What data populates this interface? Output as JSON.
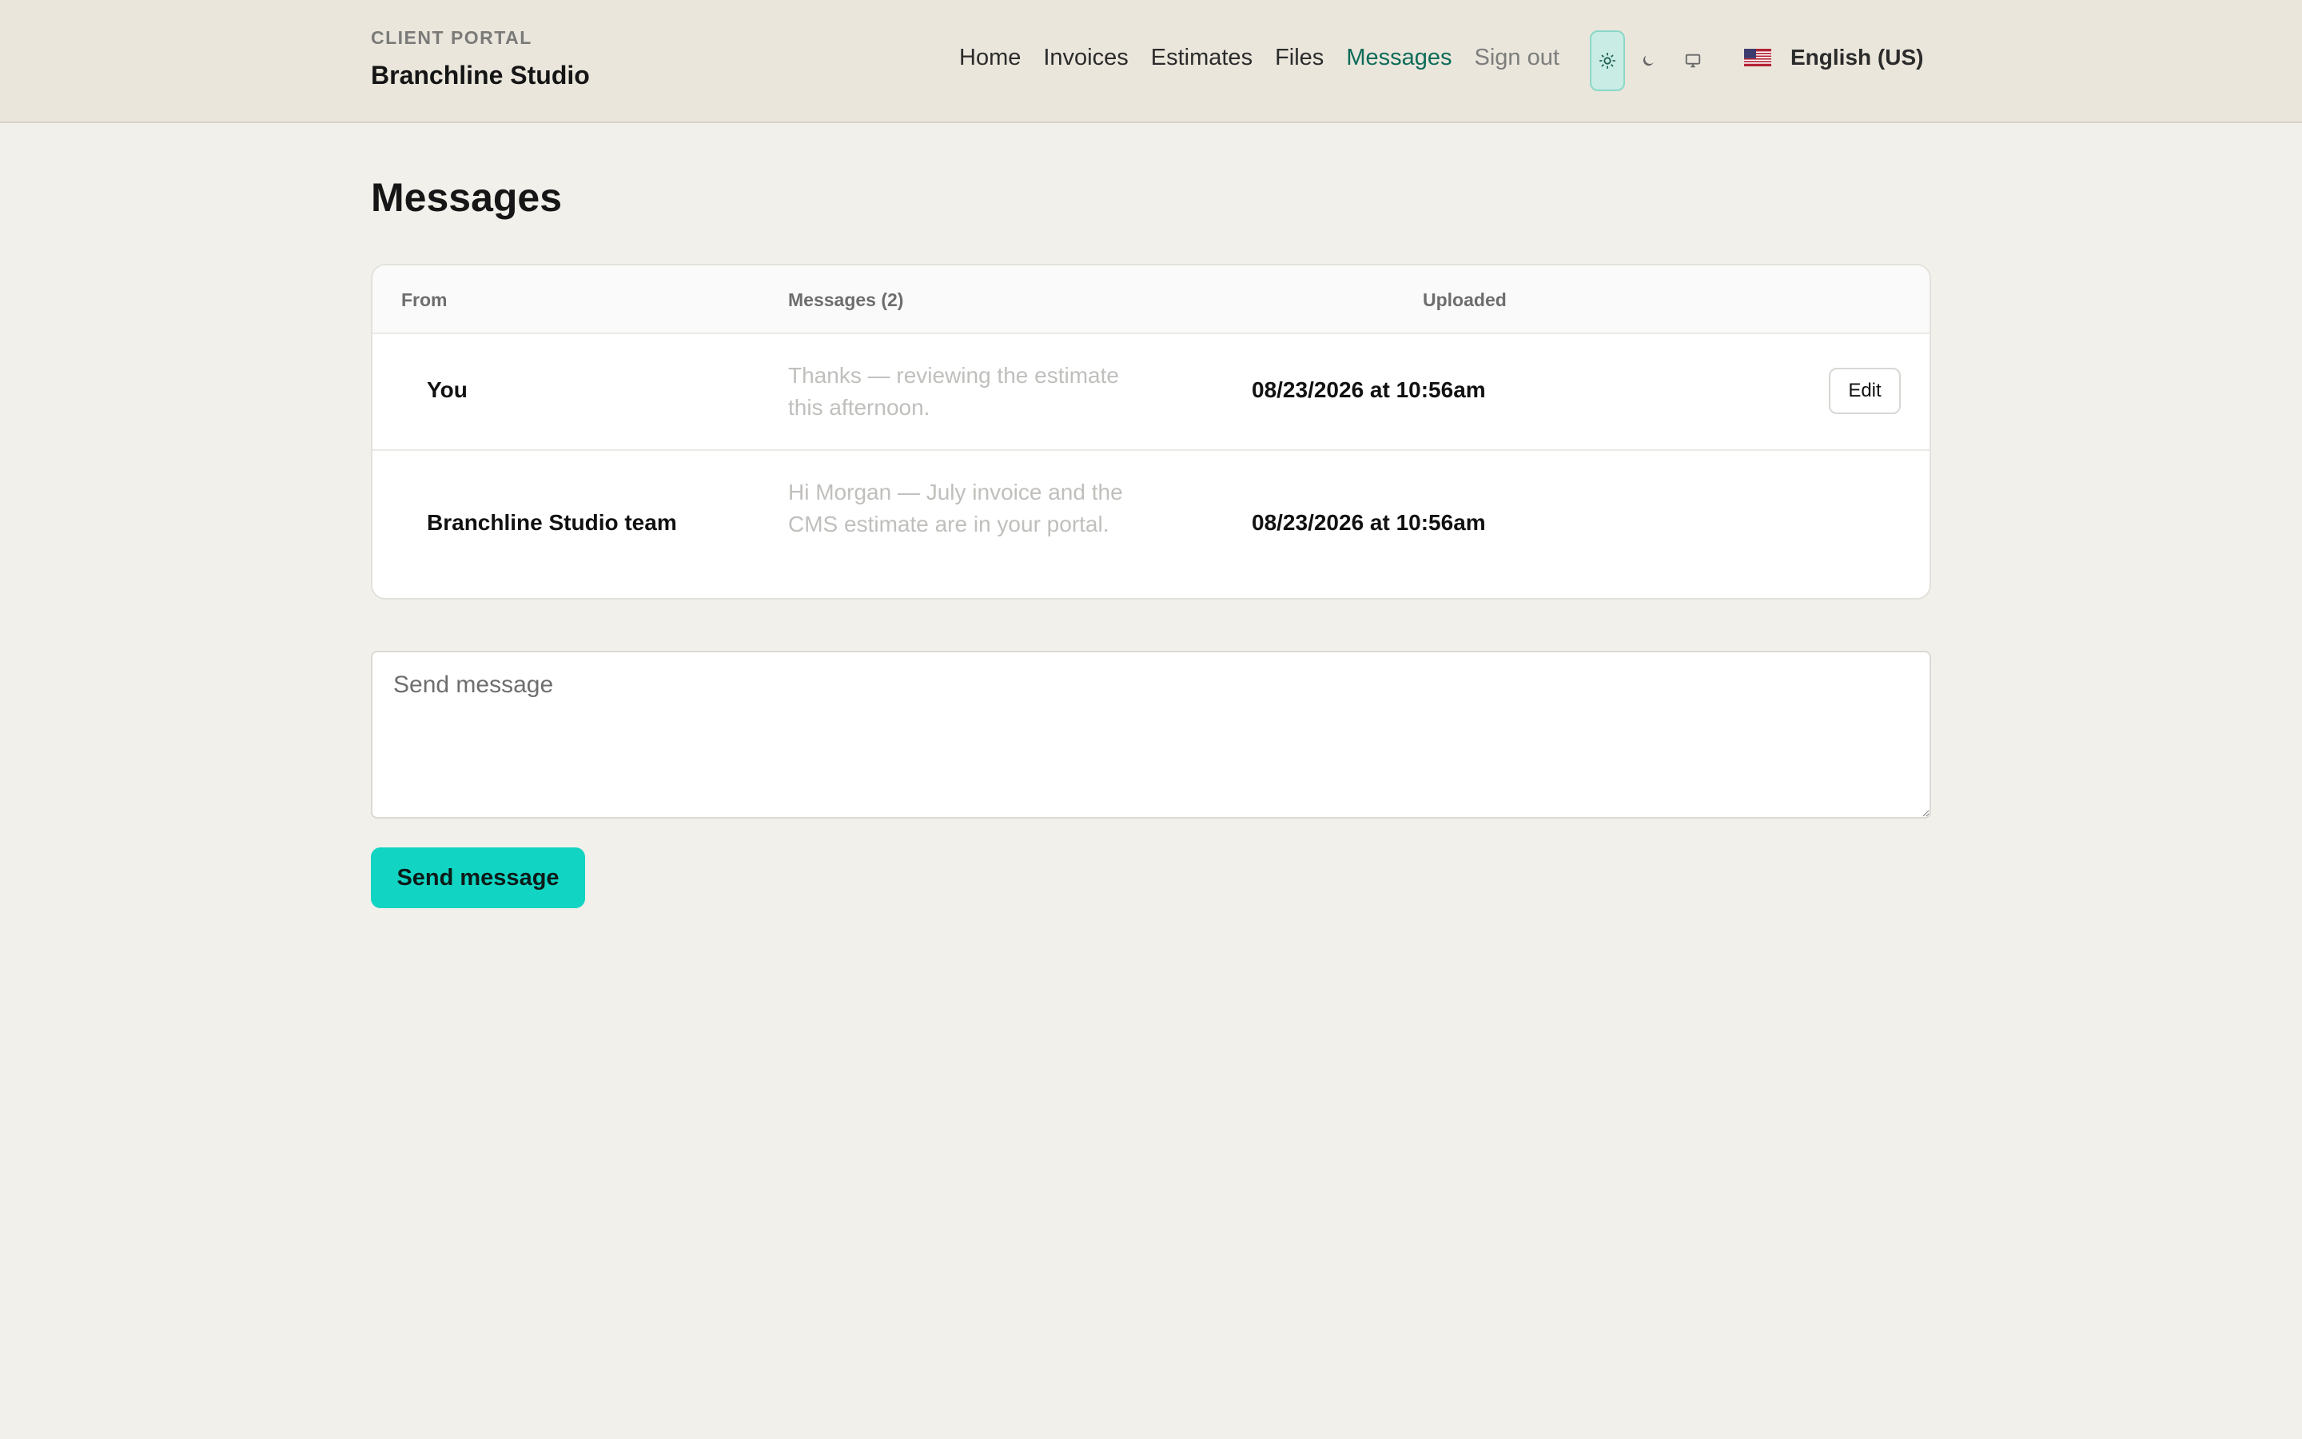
{
  "header": {
    "kicker": "CLIENT PORTAL",
    "brand": "Branchline Studio",
    "nav": {
      "home": "Home",
      "invoices": "Invoices",
      "estimates": "Estimates",
      "files": "Files",
      "messages": "Messages",
      "signout": "Sign out"
    },
    "active_nav": "Messages",
    "theme_active": "light",
    "language": "English (US)"
  },
  "main": {
    "title": "Messages",
    "table": {
      "col_from": "From",
      "col_messages": "Messages (2)",
      "col_uploaded": "Uploaded",
      "rows": [
        {
          "from": "You",
          "message": "Thanks — reviewing the estimate this afternoon.",
          "uploaded": "08/23/2026 at 10:56am",
          "action": "Edit"
        },
        {
          "from": "Branchline Studio team",
          "message": "Hi Morgan — July invoice and the CMS estimate are in your portal.",
          "uploaded": "08/23/2026 at 10:56am"
        }
      ]
    },
    "compose": {
      "placeholder": "Send message",
      "value": ""
    },
    "send_label": "Send message"
  },
  "colors": {
    "accent": "#12d4c2",
    "active_nav": "#0d6b58",
    "header_bg": "#eae6dc",
    "page_bg": "#f2f0eb"
  }
}
